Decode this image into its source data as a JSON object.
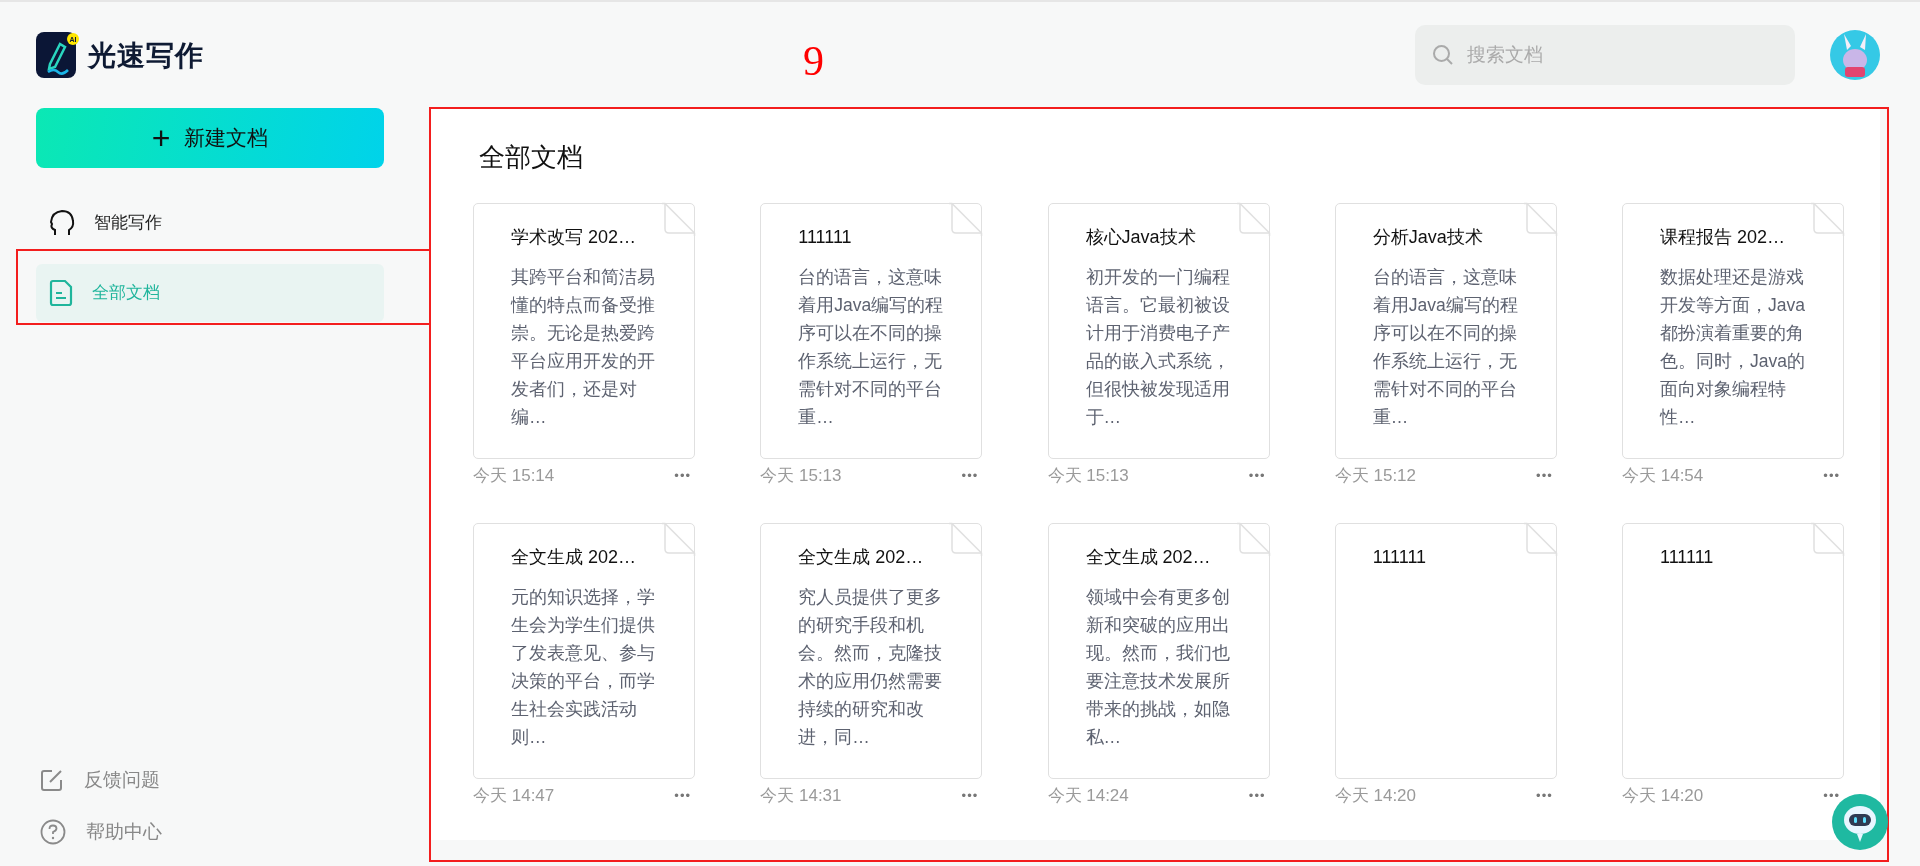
{
  "app": {
    "name": "光速写作",
    "logo_badge": "AI"
  },
  "new_button": {
    "icon": "+",
    "label": "新建文档"
  },
  "nav_items": [
    {
      "kind": "ai",
      "label": "智能写作",
      "selected": false,
      "annotated": false
    },
    {
      "kind": "docs",
      "label": "全部文档",
      "selected": true,
      "annotated": true
    }
  ],
  "footer_items": [
    {
      "kind": "feedback",
      "label": "反馈问题"
    },
    {
      "kind": "help",
      "label": "帮助中心"
    }
  ],
  "search": {
    "placeholder": "搜索文档"
  },
  "annotation": {
    "label": "9"
  },
  "panel": {
    "title": "全部文档",
    "annotated": true,
    "documents": [
      {
        "title": "学术改写 202…",
        "excerpt": "其跨平台和简洁易懂的特点而备受推崇。无论是热爱跨平台应用开发的开发者们，还是对编…",
        "time": "今天 15:14",
        "more": "•••"
      },
      {
        "title": "111111",
        "excerpt": "台的语言，这意味着用Java编写的程序可以在不同的操作系统上运行，无需针对不同的平台重…",
        "time": "今天 15:13",
        "more": "•••"
      },
      {
        "title": "核心Java技术",
        "excerpt": "初开发的一门编程语言。它最初被设计用于消费电子产品的嵌入式系统，但很快被发现适用于…",
        "time": "今天 15:13",
        "more": "•••"
      },
      {
        "title": "分析Java技术",
        "excerpt": "台的语言，这意味着用Java编写的程序可以在不同的操作系统上运行，无需针对不同的平台重…",
        "time": "今天 15:12",
        "more": "•••"
      },
      {
        "title": "课程报告 202…",
        "excerpt": "数据处理还是游戏开发等方面，Java都扮演着重要的角色。同时，Java的面向对象编程特性…",
        "time": "今天 14:54",
        "more": "•••"
      },
      {
        "title": "全文生成 202…",
        "excerpt": "元的知识选择，学生会为学生们提供了发表意见、参与决策的平台，而学生社会实践活动则…",
        "time": "今天 14:47",
        "more": "•••"
      },
      {
        "title": "全文生成 202…",
        "excerpt": "究人员提供了更多的研究手段和机会。然而，克隆技术的应用仍然需要持续的研究和改进，同…",
        "time": "今天 14:31",
        "more": "•••"
      },
      {
        "title": "全文生成 202…",
        "excerpt": "领域中会有更多创新和突破的应用出现。然而，我们也要注意技术发展所带来的挑战，如隐私…",
        "time": "今天 14:24",
        "more": "•••"
      },
      {
        "title": "111111",
        "time": "今天 14:20",
        "more": "•••"
      },
      {
        "title": "111111",
        "time": "今天 14:20",
        "more": "•••"
      }
    ]
  }
}
